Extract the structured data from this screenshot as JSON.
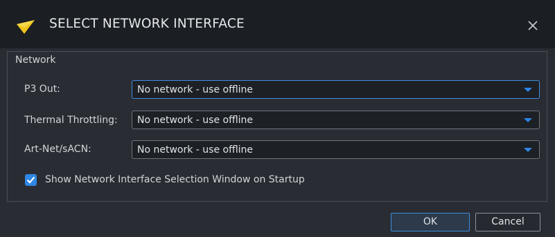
{
  "window": {
    "title": "SELECT NETWORK INTERFACE",
    "close_label": "×"
  },
  "network_group": {
    "label": "Network",
    "fields": [
      {
        "label": "P3 Out:",
        "value": "No network - use offline",
        "focused": true
      },
      {
        "label": "Thermal Throttling:",
        "value": "No network - use offline",
        "focused": false
      },
      {
        "label": "Art-Net/sACN:",
        "value": "No network - use offline",
        "focused": false
      }
    ],
    "startup_checkbox": {
      "label": "Show Network Interface Selection Window on Startup",
      "checked": true
    }
  },
  "buttons": {
    "ok": "OK",
    "cancel": "Cancel"
  },
  "colors": {
    "accent": "#2f86e4",
    "logo": "#f2c41b",
    "titlebar": "#1b1e23",
    "background": "#292d33"
  }
}
